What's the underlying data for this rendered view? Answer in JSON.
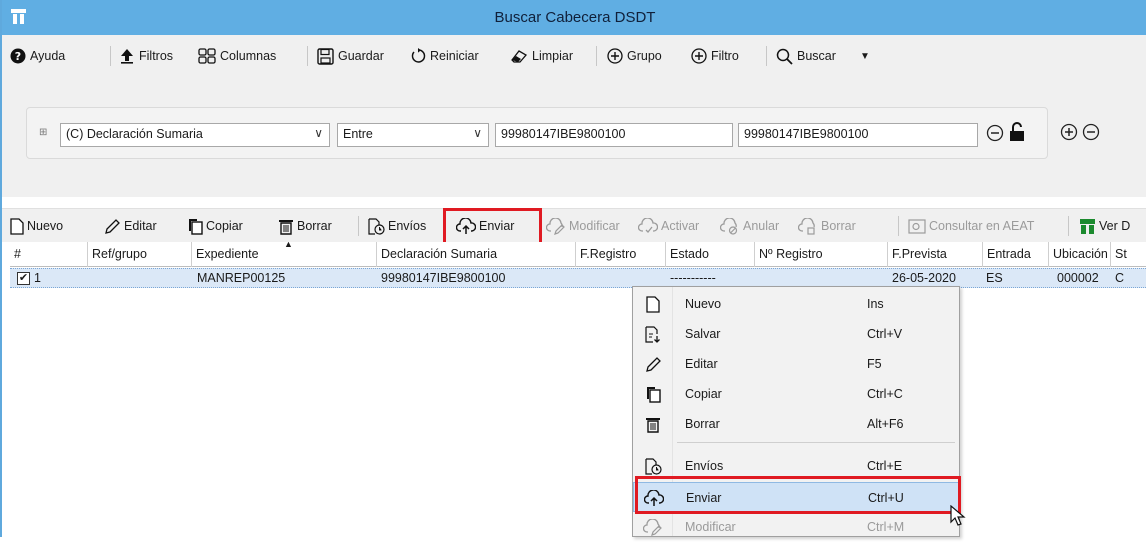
{
  "window": {
    "title": "Buscar Cabecera DSDT"
  },
  "toolbar": {
    "ayuda": "Ayuda",
    "filtros": "Filtros",
    "columnas": "Columnas",
    "guardar": "Guardar",
    "reiniciar": "Reiniciar",
    "limpiar": "Limpiar",
    "grupo": "Grupo",
    "filtro": "Filtro",
    "buscar": "Buscar"
  },
  "filter": {
    "field": "(C) Declaración Sumaria",
    "operator": "Entre",
    "value_from": "99980147IBE9800100",
    "value_to": "99980147IBE9800100"
  },
  "actions": {
    "nuevo": "Nuevo",
    "editar": "Editar",
    "copiar": "Copiar",
    "borrar": "Borrar",
    "envios": "Envíos",
    "enviar": "Enviar",
    "modificar": "Modificar",
    "activar": "Activar",
    "anular": "Anular",
    "borrar2": "Borrar",
    "consultar": "Consultar en AEAT",
    "ver": "Ver D"
  },
  "table": {
    "headers": [
      "#",
      "Ref/grupo",
      "Expediente",
      "Declaración Sumaria",
      "F.Registro",
      "Estado",
      "Nº Registro",
      "F.Prevista",
      "Entrada",
      "Ubicación",
      "St"
    ],
    "rows": [
      {
        "num": "1",
        "ref": "",
        "expediente": "MANREP00125",
        "declaracion": "99980147IBE9800100",
        "f_registro": "",
        "estado": "-----------",
        "n_registro": "",
        "f_prevista": "26-05-2020",
        "entrada": "ES",
        "ubicacion": "000002",
        "st": "C",
        "checked": true
      }
    ]
  },
  "context_menu": [
    {
      "label": "Nuevo",
      "shortcut": "Ins",
      "icon": "new-document-icon"
    },
    {
      "label": "Salvar",
      "shortcut": "Ctrl+V",
      "icon": "save-document-icon"
    },
    {
      "label": "Editar",
      "shortcut": "F5",
      "icon": "pencil-icon"
    },
    {
      "label": "Copiar",
      "shortcut": "Ctrl+C",
      "icon": "copy-icon"
    },
    {
      "label": "Borrar",
      "shortcut": "Alt+F6",
      "icon": "trash-icon"
    },
    {
      "label": "Envíos",
      "shortcut": "Ctrl+E",
      "icon": "envios-icon"
    },
    {
      "label": "Enviar",
      "shortcut": "Ctrl+U",
      "icon": "cloud-upload-icon",
      "selected": true
    },
    {
      "label": "Modificar",
      "shortcut": "Ctrl+M",
      "icon": "modify-icon",
      "disabled": true
    }
  ],
  "colors": {
    "titlebar": "#60aee3",
    "highlight": "#e01a22",
    "selection": "#cfe2f6",
    "row_selected": "#dbe8f7"
  }
}
